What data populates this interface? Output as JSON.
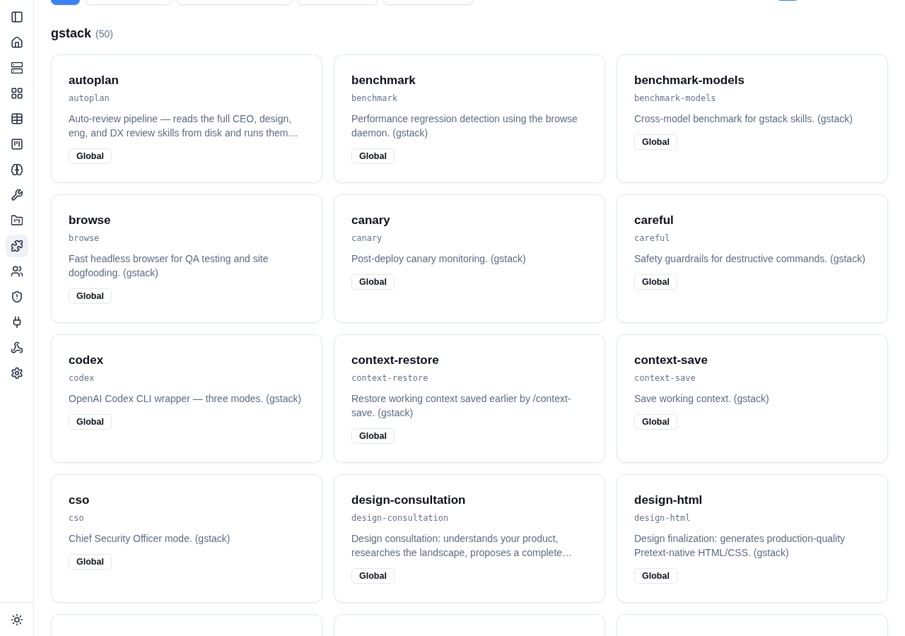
{
  "toolbar": {
    "buttons": [
      {
        "selected": true
      },
      {
        "selected": false
      },
      {
        "selected": false
      },
      {
        "selected": false
      },
      {
        "selected": false
      }
    ],
    "toggle": {
      "on": true
    }
  },
  "sidebar": {
    "items": [
      {
        "selected": false
      },
      {
        "selected": false
      },
      {
        "selected": false
      },
      {
        "selected": false
      },
      {
        "selected": false
      },
      {
        "selected": false
      },
      {
        "selected": false
      },
      {
        "selected": false
      },
      {
        "selected": false
      },
      {
        "selected": true
      },
      {
        "selected": false
      },
      {
        "selected": false
      },
      {
        "selected": false
      },
      {
        "selected": false
      },
      {
        "selected": false
      }
    ]
  },
  "section": {
    "title": "gstack",
    "count": "(50)"
  },
  "cards": [
    {
      "kind": "skill",
      "title": "autoplan",
      "id": "autoplan",
      "description": "Auto-review pipeline — reads the full CEO, design, eng, and DX review skills from disk and runs them…",
      "badge": "Global"
    },
    {
      "kind": "skill",
      "title": "benchmark",
      "id": "benchmark",
      "description": "Performance regression detection using the browse daemon. (gstack)",
      "badge": "Global"
    },
    {
      "kind": "skill",
      "title": "benchmark-models",
      "id": "benchmark-models",
      "description": "Cross-model benchmark for gstack skills. (gstack)",
      "badge": "Global"
    },
    {
      "kind": "skill",
      "title": "browse",
      "id": "browse",
      "description": "Fast headless browser for QA testing and site dogfooding. (gstack)",
      "badge": "Global"
    },
    {
      "kind": "skill",
      "title": "canary",
      "id": "canary",
      "description": "Post-deploy canary monitoring. (gstack)",
      "badge": "Global"
    },
    {
      "kind": "skill",
      "title": "careful",
      "id": "careful",
      "description": "Safety guardrails for destructive commands. (gstack)",
      "badge": "Global"
    },
    {
      "kind": "skill",
      "title": "codex",
      "id": "codex",
      "description": "OpenAI Codex CLI wrapper — three modes. (gstack)",
      "badge": "Global"
    },
    {
      "kind": "skill",
      "title": "context-restore",
      "id": "context-restore",
      "description": "Restore working context saved earlier by /context-save. (gstack)",
      "badge": "Global"
    },
    {
      "kind": "skill",
      "title": "context-save",
      "id": "context-save",
      "description": "Save working context. (gstack)",
      "badge": "Global"
    },
    {
      "kind": "skill",
      "title": "cso",
      "id": "cso",
      "description": "Chief Security Officer mode. (gstack)",
      "badge": "Global"
    },
    {
      "kind": "skill",
      "title": "design-consultation",
      "id": "design-consultation",
      "description": "Design consultation: understands your product, researches the landscape, proposes a complete…",
      "badge": "Global"
    },
    {
      "kind": "skill",
      "title": "design-html",
      "id": "design-html",
      "description": "Design finalization: generates production-quality Pretext-native HTML/CSS. (gstack)",
      "badge": "Global"
    },
    {
      "kind": "clipped"
    },
    {
      "kind": "clipped"
    },
    {
      "kind": "clipped"
    }
  ]
}
